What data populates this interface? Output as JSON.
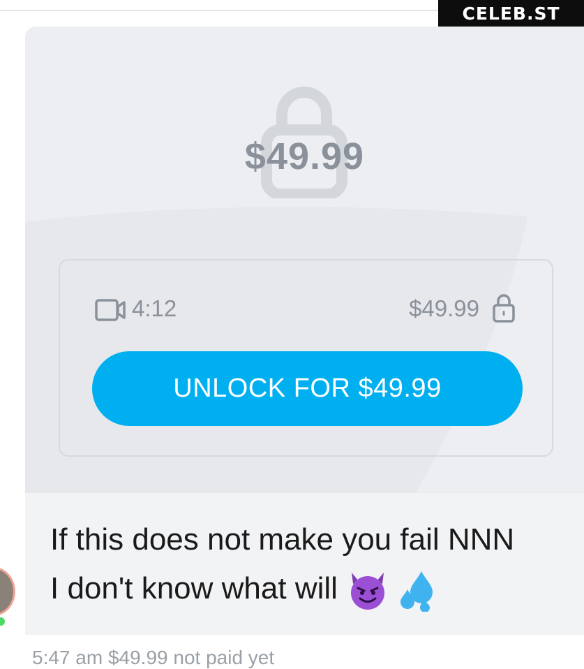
{
  "watermark": "CELEB.ST",
  "preview": {
    "price": "$49.99"
  },
  "media": {
    "duration": "4:12",
    "price": "$49.99"
  },
  "unlock_button_label": "UNLOCK FOR $49.99",
  "message": {
    "line1": "If this does not make you fail NNN",
    "line2": "I don't know what will"
  },
  "meta": "5:47 am   $49.99 not paid yet",
  "colors": {
    "accent": "#00aff0",
    "card_bg": "#f2f3f5",
    "muted_text": "#8a919a"
  },
  "icons": {
    "lock": "lock-icon",
    "video": "video-camera-icon",
    "emoji1": "smiling-devil-emoji",
    "emoji2": "sweat-droplets-emoji"
  }
}
